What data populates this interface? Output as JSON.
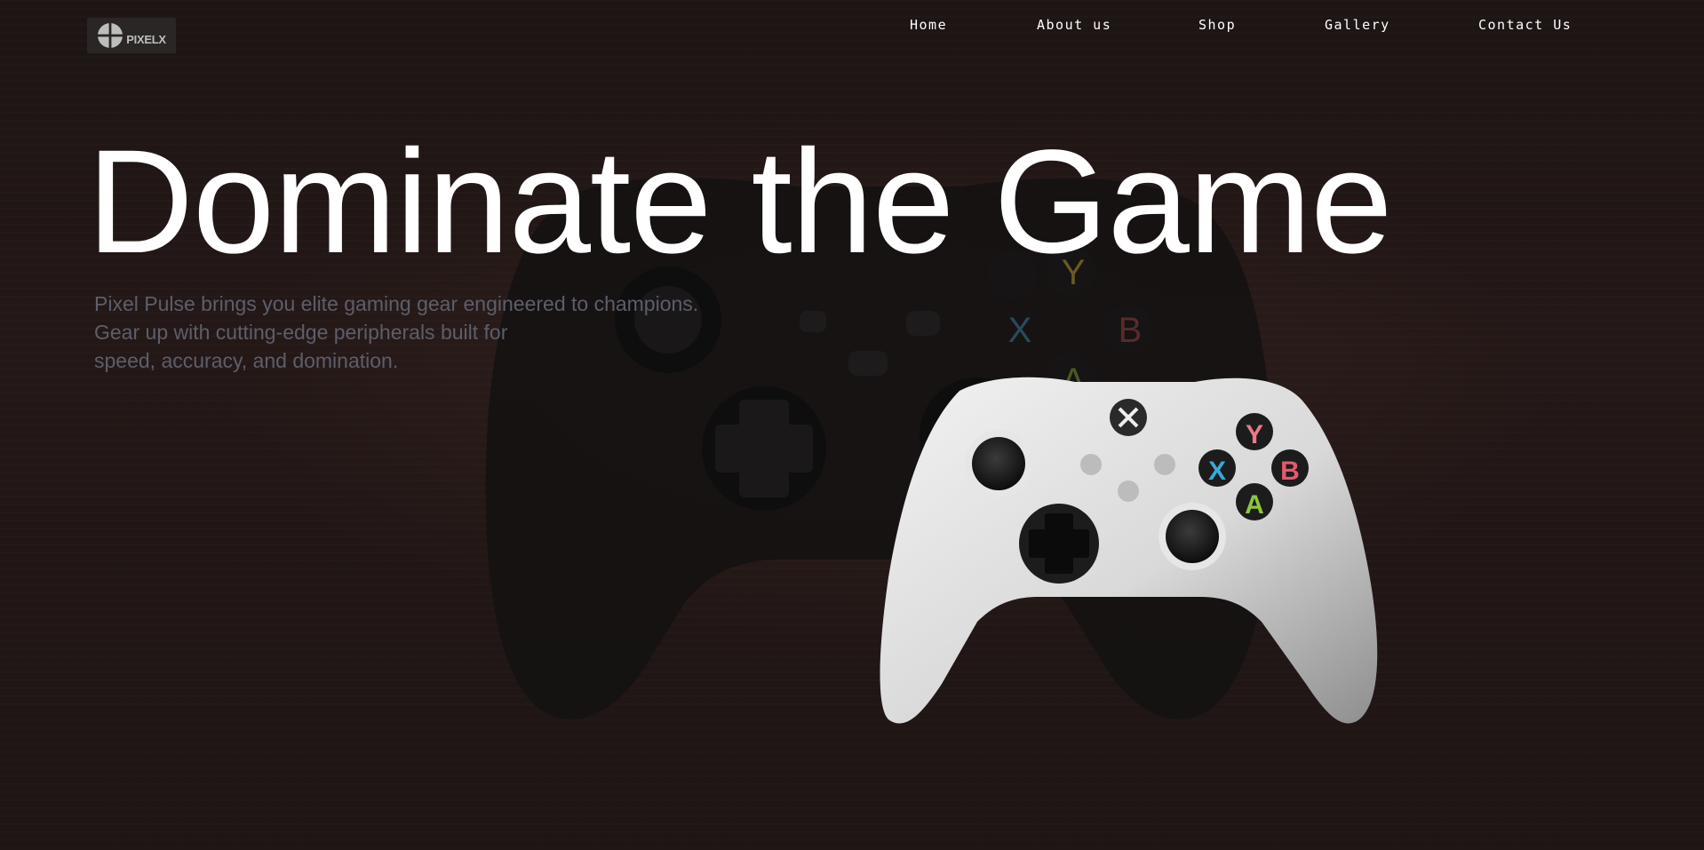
{
  "brand": {
    "logo_text": "PIXELX"
  },
  "nav": {
    "items": [
      "Home",
      "About us",
      "Shop",
      "Gallery",
      "Contact Us"
    ]
  },
  "hero": {
    "title": "Dominate the Game",
    "description_lines": [
      "Pixel Pulse brings you elite gaming gear engineered to champions.",
      "Gear up with cutting-edge peripherals built for",
      "speed, accuracy, and domination."
    ]
  },
  "controller_buttons": {
    "y": "Y",
    "x": "X",
    "b": "B",
    "a": "A"
  },
  "colors": {
    "background": "#1c1413",
    "title": "#ffffff",
    "description": "#5d5e6b",
    "button_y": "#e87a88",
    "button_x": "#38a8d8",
    "button_b": "#e55a6a",
    "button_a": "#8cc63f"
  }
}
